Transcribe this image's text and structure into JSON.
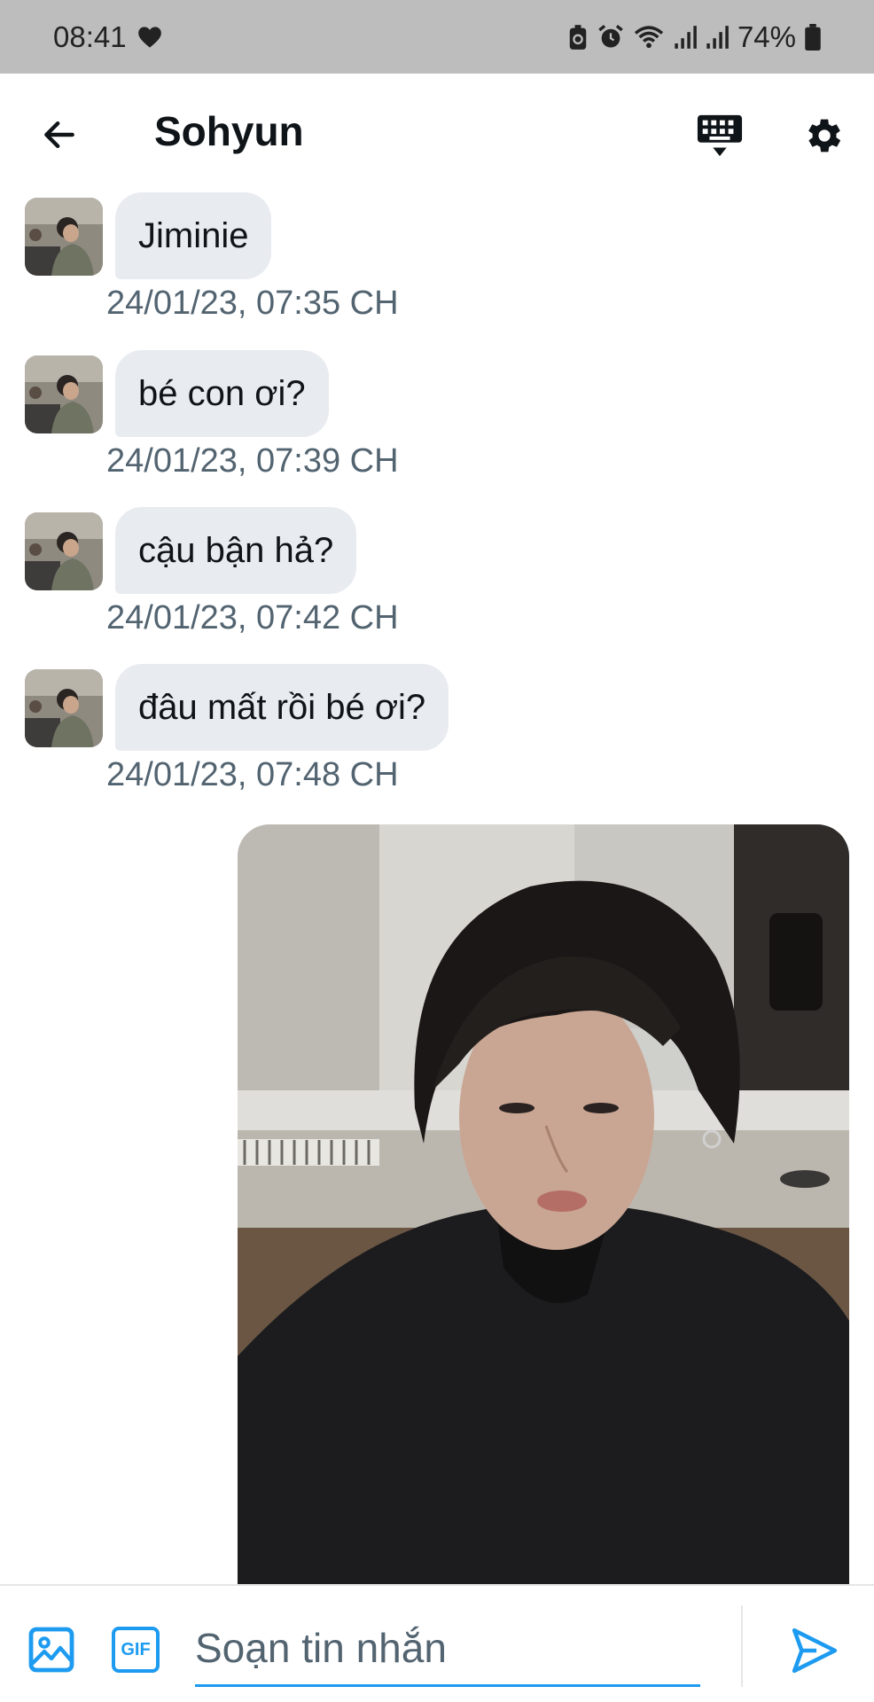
{
  "status_bar": {
    "time": "08:41",
    "battery": "74%",
    "icons": [
      "heart-icon",
      "battery-saver-icon",
      "alarm-icon",
      "wifi-icon",
      "signal-icon",
      "signal-icon",
      "battery-icon"
    ]
  },
  "header": {
    "title": "Sohyun",
    "icons": [
      "back-arrow-icon",
      "keyboard-icon",
      "gear-icon"
    ]
  },
  "messages": [
    {
      "text": "Jiminie",
      "time": "24/01/23, 07:35 CH"
    },
    {
      "text": "bé con ơi?",
      "time": "24/01/23, 07:39 CH"
    },
    {
      "text": "cậu bận hả?",
      "time": "24/01/23, 07:42 CH"
    },
    {
      "text": "đâu mất rồi bé ơi?",
      "time": "24/01/23, 07:48 CH"
    }
  ],
  "composer": {
    "placeholder": "Soạn tin nhắn",
    "gif_label": "GIF",
    "icons": [
      "image-icon",
      "gif-icon",
      "send-icon"
    ]
  },
  "colors": {
    "accent": "#1d9bf0",
    "bubble": "#e8ebef",
    "timestamp": "#536471",
    "status_bar": "#bdbdbd"
  }
}
